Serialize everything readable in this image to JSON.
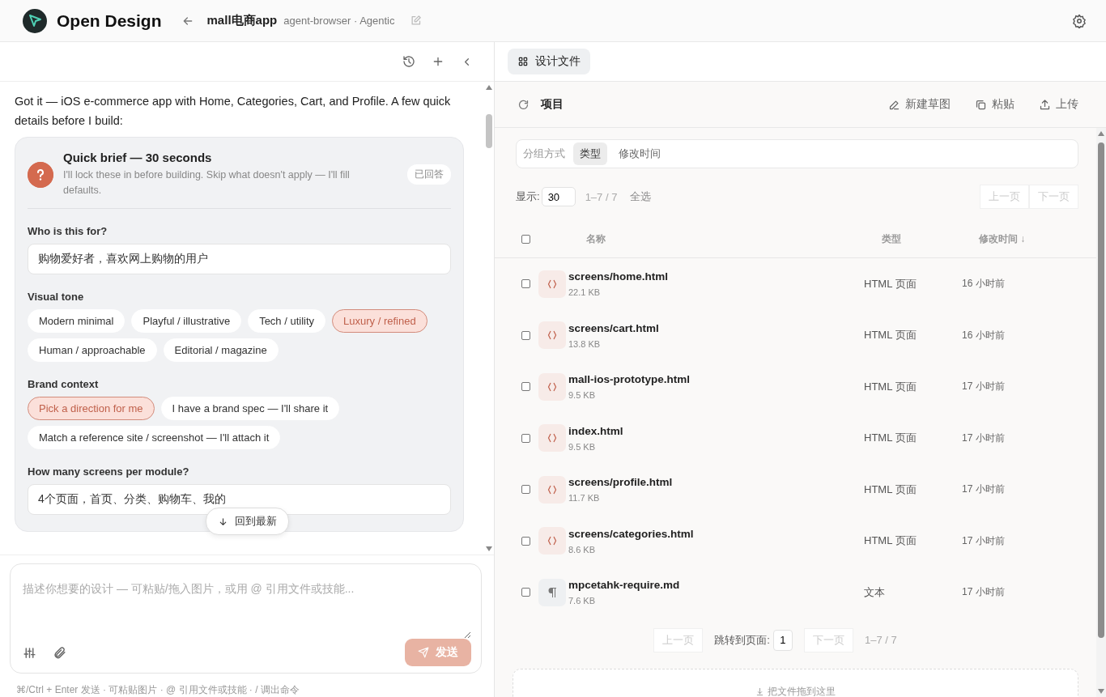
{
  "app": {
    "name": "Open Design"
  },
  "project": {
    "title": "mall电商app",
    "meta": "agent-browser · Agentic"
  },
  "chat": {
    "message": "Got it — iOS e-commerce app with Home, Categories, Cart, and Profile. A few quick details before I build:",
    "brief": {
      "title": "Quick brief — 30 seconds",
      "subtitle": "I'll lock these in before building. Skip what doesn't apply — I'll fill defaults.",
      "status": "已回答",
      "questions": [
        {
          "kind": "text",
          "label": "Who is this for?",
          "value": "购物爱好者，喜欢网上购物的用户"
        },
        {
          "kind": "choice",
          "label": "Visual tone",
          "options": [
            {
              "label": "Modern minimal",
              "selected": false
            },
            {
              "label": "Playful / illustrative",
              "selected": false
            },
            {
              "label": "Tech / utility",
              "selected": false
            },
            {
              "label": "Luxury / refined",
              "selected": true
            },
            {
              "label": "Human / approachable",
              "selected": false
            },
            {
              "label": "Editorial / magazine",
              "selected": false
            }
          ]
        },
        {
          "kind": "choice",
          "label": "Brand context",
          "options": [
            {
              "label": "Pick a direction for me",
              "selected": true
            },
            {
              "label": "I have a brand spec — I'll share it",
              "selected": false
            },
            {
              "label": "Match a reference site / screenshot — I'll attach it",
              "selected": false
            }
          ]
        },
        {
          "kind": "text",
          "label": "How many screens per module?",
          "value": "4个页面，首页、分类、购物车、我的"
        }
      ]
    },
    "jump_button": "回到最新"
  },
  "composer": {
    "placeholder": "描述你想要的设计 — 可粘贴/拖入图片，或用 @ 引用文件或技能...",
    "send": "发送",
    "hint": "⌘/Ctrl + Enter 发送 · 可粘贴图片 · @ 引用文件或技能 · / 调出命令"
  },
  "files_panel": {
    "tabs": [
      {
        "label": "设计文件",
        "selected": true
      }
    ],
    "breadcrumb": "项目",
    "actions": [
      {
        "kind": "draw",
        "label": "新建草图"
      },
      {
        "kind": "paste",
        "label": "粘贴"
      },
      {
        "kind": "upload",
        "label": "上传"
      }
    ],
    "group_by": {
      "label": "分组方式",
      "options": [
        {
          "label": "类型",
          "selected": true
        },
        {
          "label": "修改时间",
          "selected": false
        }
      ]
    },
    "display_label": "显示:",
    "page_size": "30",
    "range": "1–7 / 7",
    "select_all": "全选",
    "prev": {
      "label": "上一页",
      "disabled": true
    },
    "next": {
      "label": "下一页",
      "disabled": true
    },
    "header_checked": false,
    "columns": [
      "名称",
      "类型",
      "修改时间 ↓"
    ],
    "rows": [
      {
        "kind": "html",
        "name": "screens/home.html",
        "size": "22.1 KB",
        "type": "HTML 页面",
        "modified": "16 小时前",
        "checked": false
      },
      {
        "kind": "html",
        "name": "screens/cart.html",
        "size": "13.8 KB",
        "type": "HTML 页面",
        "modified": "16 小时前",
        "checked": false
      },
      {
        "kind": "html",
        "name": "mall-ios-prototype.html",
        "size": "9.5 KB",
        "type": "HTML 页面",
        "modified": "17 小时前",
        "checked": false
      },
      {
        "kind": "html",
        "name": "index.html",
        "size": "9.5 KB",
        "type": "HTML 页面",
        "modified": "17 小时前",
        "checked": false
      },
      {
        "kind": "html",
        "name": "screens/profile.html",
        "size": "11.7 KB",
        "type": "HTML 页面",
        "modified": "17 小时前",
        "checked": false
      },
      {
        "kind": "html",
        "name": "screens/categories.html",
        "size": "8.6 KB",
        "type": "HTML 页面",
        "modified": "17 小时前",
        "checked": false
      },
      {
        "kind": "text",
        "name": "mpcetahk-require.md",
        "size": "7.6 KB",
        "type": "文本",
        "modified": "17 小时前",
        "checked": false
      }
    ],
    "pagination": {
      "prev": {
        "label": "上一页",
        "disabled": true
      },
      "jump_label": "跳转到页面:",
      "page": "1",
      "next": {
        "label": "下一页",
        "disabled": true
      },
      "range": "1–7 / 7"
    },
    "drop_hint": "把文件拖到这里"
  }
}
